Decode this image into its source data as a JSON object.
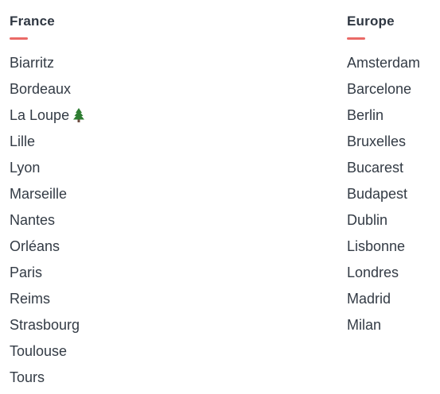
{
  "france": {
    "title": "France",
    "cities": [
      {
        "label": "Biarritz"
      },
      {
        "label": "Bordeaux"
      },
      {
        "label": "La Loupe",
        "icon": "pine-tree-icon"
      },
      {
        "label": "Lille"
      },
      {
        "label": "Lyon"
      },
      {
        "label": "Marseille"
      },
      {
        "label": "Nantes"
      },
      {
        "label": "Orléans"
      },
      {
        "label": "Paris"
      },
      {
        "label": "Reims"
      },
      {
        "label": "Strasbourg"
      },
      {
        "label": "Toulouse"
      },
      {
        "label": "Tours"
      }
    ]
  },
  "europe": {
    "title": "Europe",
    "cities": [
      {
        "label": "Amsterdam"
      },
      {
        "label": "Barcelone"
      },
      {
        "label": "Berlin"
      },
      {
        "label": "Bruxelles"
      },
      {
        "label": "Bucarest"
      },
      {
        "label": "Budapest"
      },
      {
        "label": "Dublin"
      },
      {
        "label": "Lisbonne"
      },
      {
        "label": "Londres"
      },
      {
        "label": "Madrid"
      },
      {
        "label": "Milan"
      }
    ]
  },
  "colors": {
    "accent": "#ea6a67",
    "text": "#333b45"
  }
}
